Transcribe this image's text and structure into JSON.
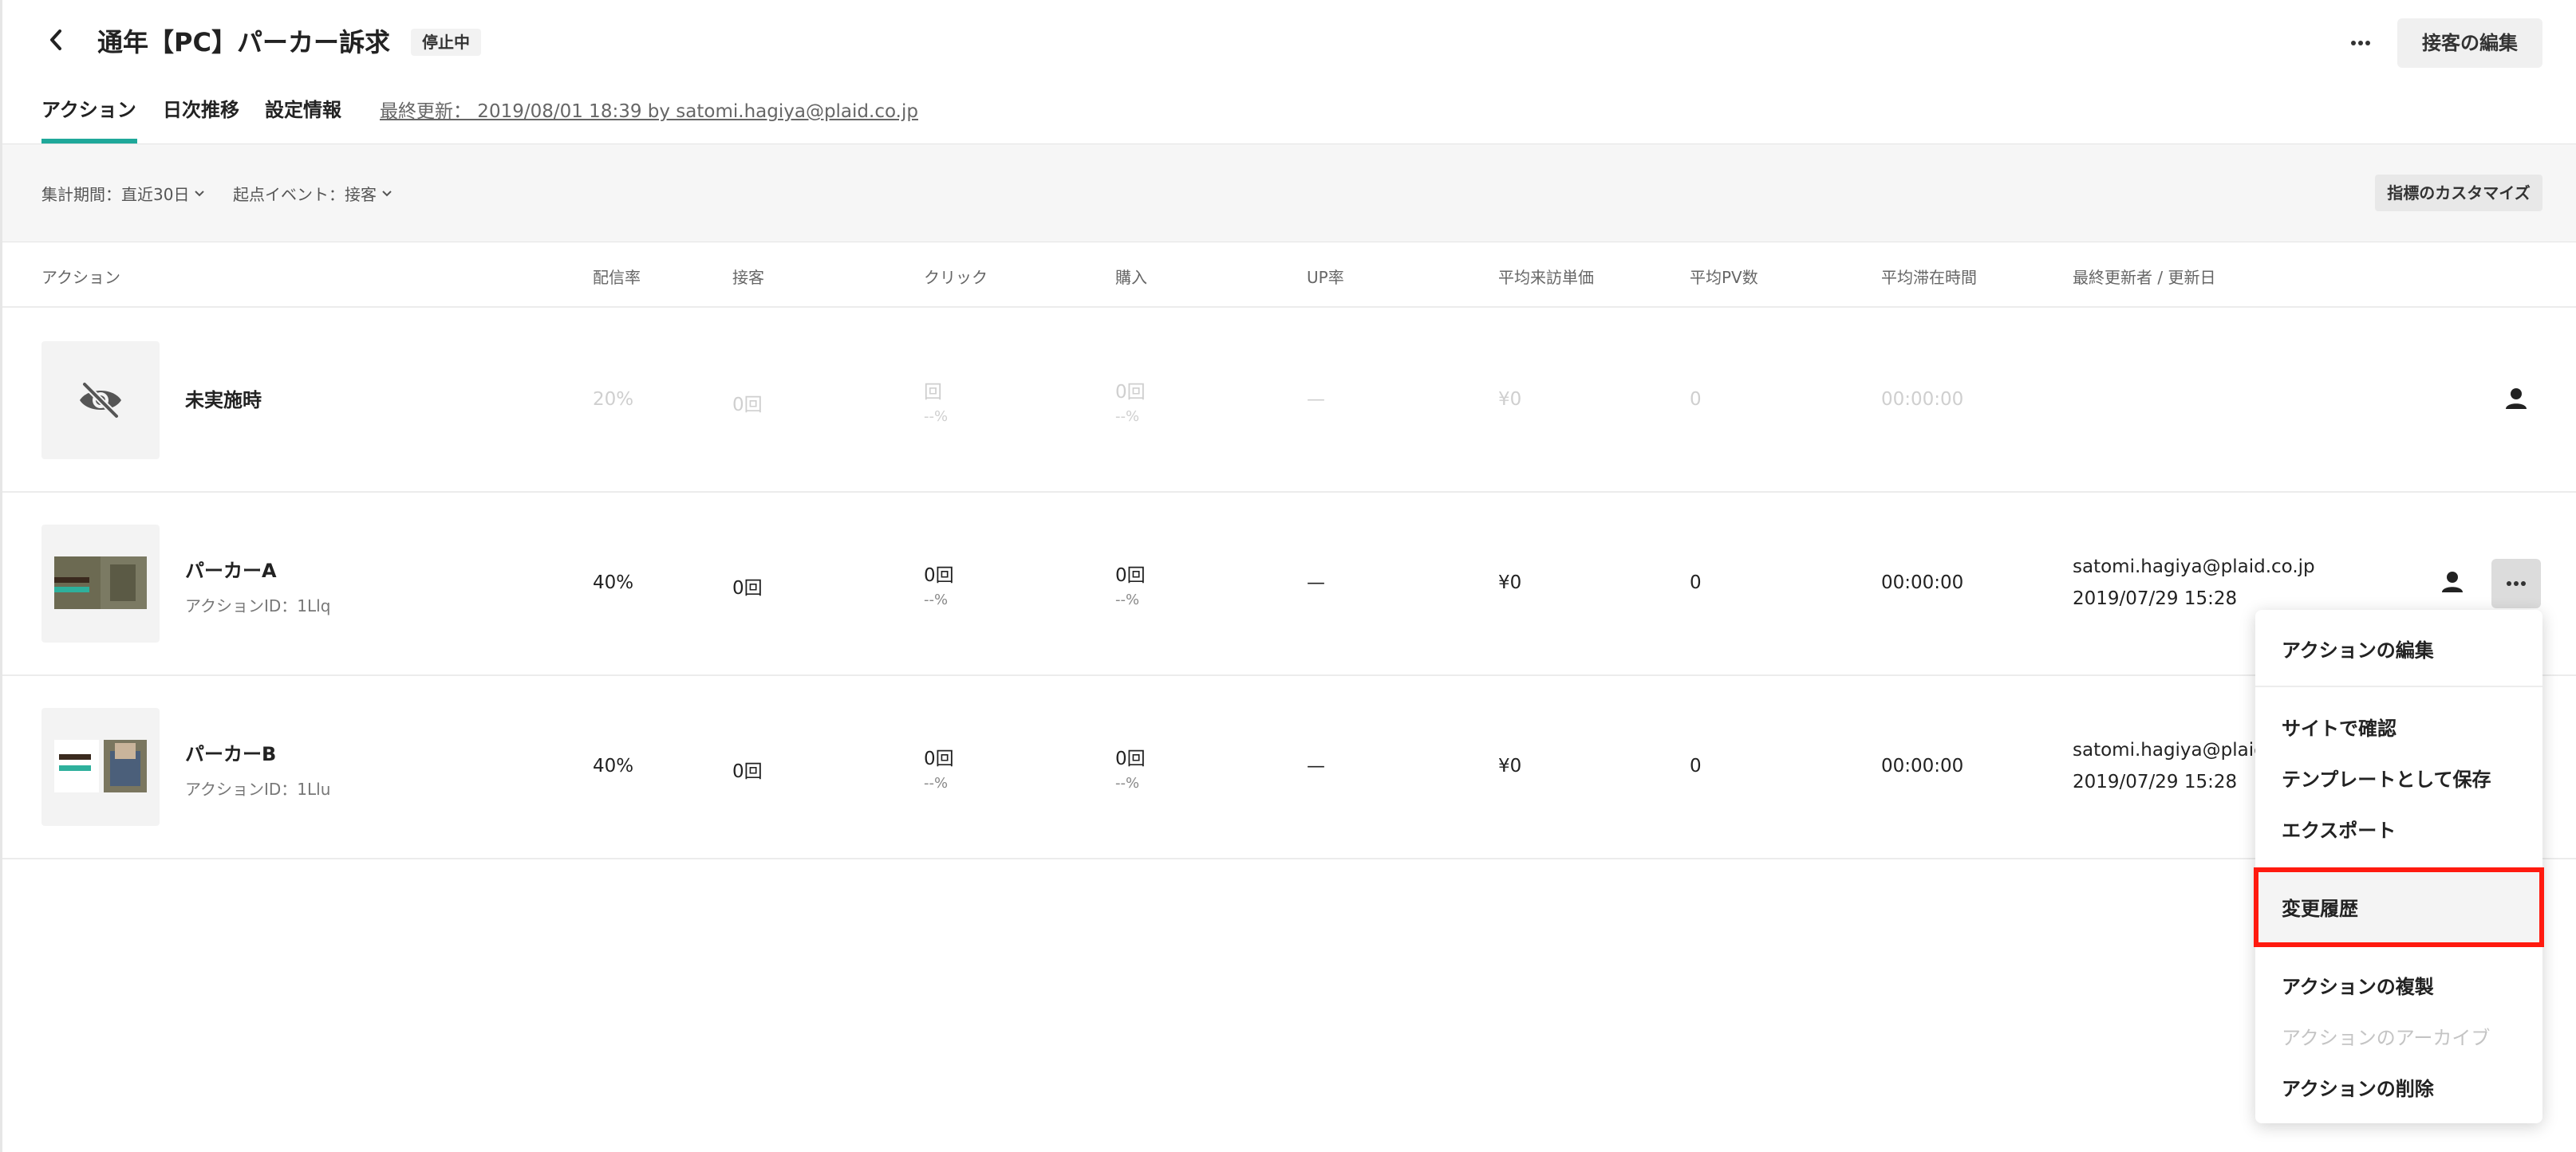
{
  "header": {
    "title": "通年【PC】パーカー訴求",
    "status_badge": "停止中",
    "edit_button": "接客の編集"
  },
  "tabs": [
    {
      "label": "アクション",
      "active": true
    },
    {
      "label": "日次推移",
      "active": false
    },
    {
      "label": "設定情報",
      "active": false
    }
  ],
  "last_updated": "最終更新： 2019/08/01 18:39 by satomi.hagiya@plaid.co.jp",
  "filters": {
    "period": "集計期間：直近30日",
    "event": "起点イベント：接客",
    "customize_button": "指標のカスタマイズ"
  },
  "columns": [
    "アクション",
    "配信率",
    "接客",
    "クリック",
    "購入",
    "UP率",
    "平均来訪単価",
    "平均PV数",
    "平均滞在時間",
    "最終更新者 / 更新日"
  ],
  "rows": [
    {
      "name": "未実施時",
      "id_label": "",
      "delivery": "20%",
      "visits": "0回",
      "click": "回",
      "click_rate": "--%",
      "purchase": "0回",
      "purchase_rate": "--%",
      "up": "—",
      "avg_price": "¥0",
      "avg_pv": "0",
      "avg_time": "00:00:00",
      "updater": "",
      "updated_at": ""
    },
    {
      "name": "パーカーA",
      "id_label": "アクションID：1Llq",
      "delivery": "40%",
      "visits": "0回",
      "click": "0回",
      "click_rate": "--%",
      "purchase": "0回",
      "purchase_rate": "--%",
      "up": "—",
      "avg_price": "¥0",
      "avg_pv": "0",
      "avg_time": "00:00:00",
      "updater": "satomi.hagiya@plaid.co.jp",
      "updated_at": "2019/07/29 15:28"
    },
    {
      "name": "パーカーB",
      "id_label": "アクションID：1Llu",
      "delivery": "40%",
      "visits": "0回",
      "click": "0回",
      "click_rate": "--%",
      "purchase": "0回",
      "purchase_rate": "--%",
      "up": "—",
      "avg_price": "¥0",
      "avg_pv": "0",
      "avg_time": "00:00:00",
      "updater": "satomi.hagiya@plaid.",
      "updated_at": "2019/07/29 15:28"
    }
  ],
  "menu": {
    "items": [
      {
        "label": "アクションの編集",
        "disabled": false
      },
      {
        "label": "サイトで確認",
        "disabled": false
      },
      {
        "label": "テンプレートとして保存",
        "disabled": false
      },
      {
        "label": "エクスポート",
        "disabled": false
      },
      {
        "label": "変更履歴",
        "disabled": false,
        "highlighted": true
      },
      {
        "label": "アクションの複製",
        "disabled": false
      },
      {
        "label": "アクションのアーカイブ",
        "disabled": true
      },
      {
        "label": "アクションの削除",
        "disabled": false
      }
    ]
  },
  "colors": {
    "accent": "#1fa89a",
    "highlight_border": "#ff1a0f"
  }
}
